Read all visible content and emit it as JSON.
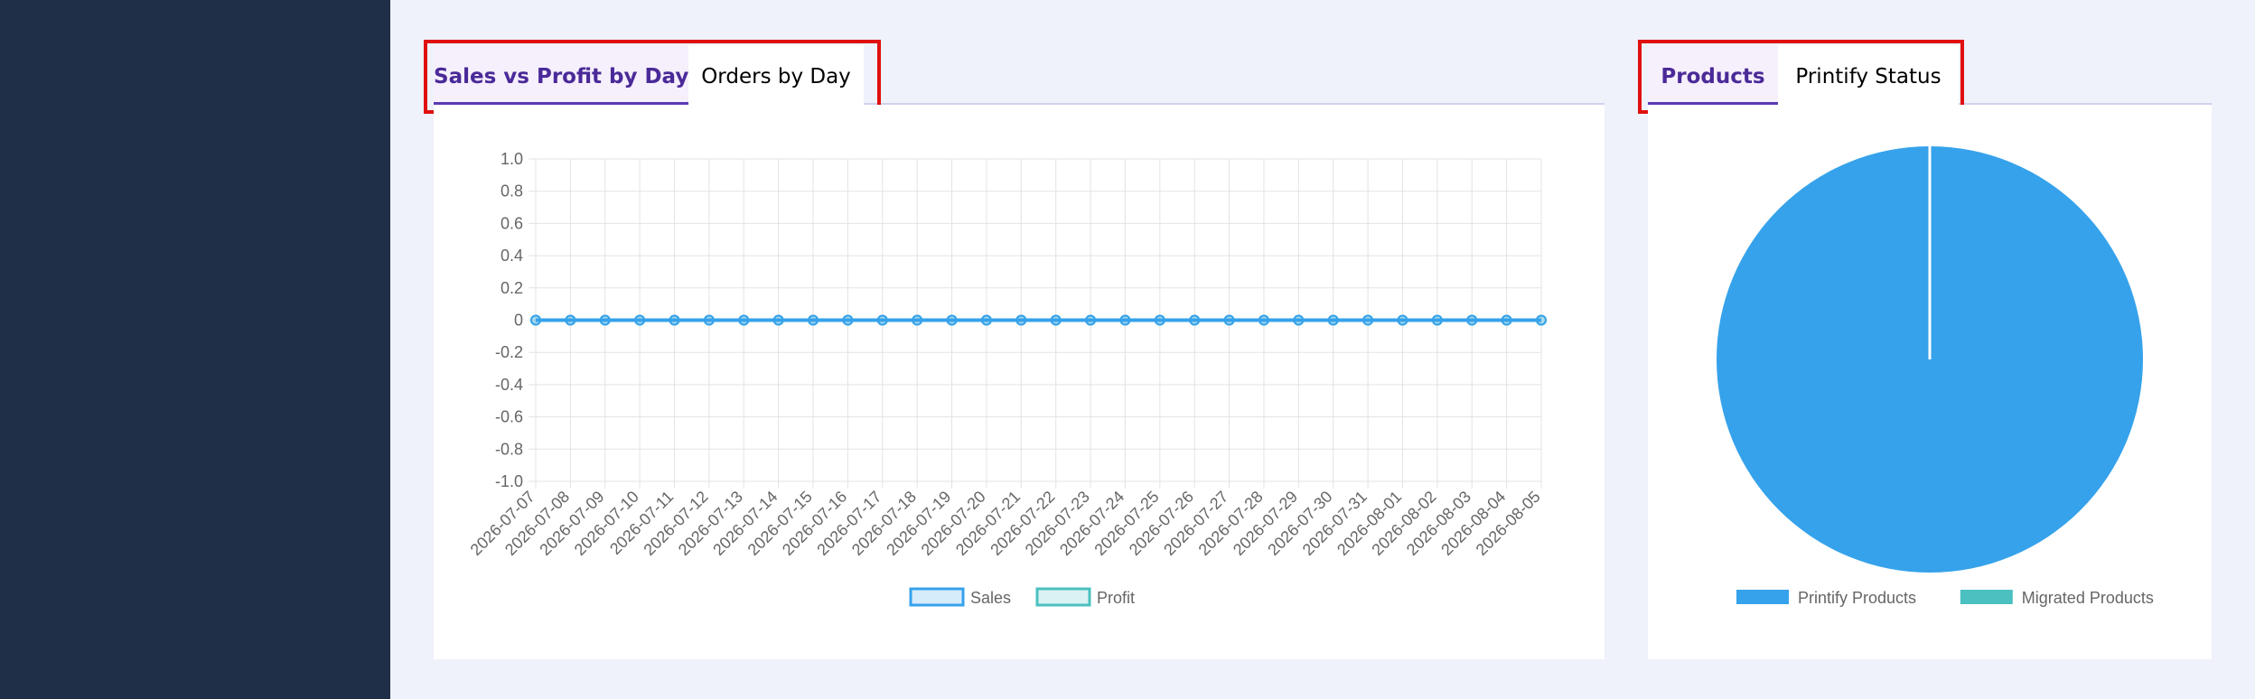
{
  "left_panel": {
    "tabs": [
      {
        "label": "Sales vs Profit by Day",
        "active": true
      },
      {
        "label": "Orders by Day",
        "active": false
      }
    ]
  },
  "right_panel": {
    "tabs": [
      {
        "label": "Products",
        "active": true
      },
      {
        "label": "Printify Status",
        "active": false
      }
    ]
  },
  "colors": {
    "sales": "#36a2eb",
    "profit": "#4bc0c0",
    "active_tab_text": "#4a2a98",
    "sidebar": "#1f2f47"
  },
  "chart_data": [
    {
      "type": "line",
      "x": [
        "2026-07-07",
        "2026-07-08",
        "2026-07-09",
        "2026-07-10",
        "2026-07-11",
        "2026-07-12",
        "2026-07-13",
        "2026-07-14",
        "2026-07-15",
        "2026-07-16",
        "2026-07-17",
        "2026-07-18",
        "2026-07-19",
        "2026-07-20",
        "2026-07-21",
        "2026-07-22",
        "2026-07-23",
        "2026-07-24",
        "2026-07-25",
        "2026-07-26",
        "2026-07-27",
        "2026-07-28",
        "2026-07-29",
        "2026-07-30",
        "2026-07-31",
        "2026-08-01",
        "2026-08-02",
        "2026-08-03",
        "2026-08-04",
        "2026-08-05"
      ],
      "series": [
        {
          "name": "Sales",
          "values": [
            0,
            0,
            0,
            0,
            0,
            0,
            0,
            0,
            0,
            0,
            0,
            0,
            0,
            0,
            0,
            0,
            0,
            0,
            0,
            0,
            0,
            0,
            0,
            0,
            0,
            0,
            0,
            0,
            0,
            0
          ]
        },
        {
          "name": "Profit",
          "values": [
            0,
            0,
            0,
            0,
            0,
            0,
            0,
            0,
            0,
            0,
            0,
            0,
            0,
            0,
            0,
            0,
            0,
            0,
            0,
            0,
            0,
            0,
            0,
            0,
            0,
            0,
            0,
            0,
            0,
            0
          ]
        }
      ],
      "ylim": [
        -1.0,
        1.0
      ],
      "yticks": [
        "1.0",
        "0.8",
        "0.6",
        "0.4",
        "0.2",
        "0",
        "-0.2",
        "-0.4",
        "-0.6",
        "-0.8",
        "-1.0"
      ],
      "grid": true,
      "legend": "bottom"
    },
    {
      "type": "pie",
      "labels": [
        "Printify Products",
        "Migrated Products"
      ],
      "values": [
        1,
        0
      ],
      "legend": "bottom"
    }
  ]
}
